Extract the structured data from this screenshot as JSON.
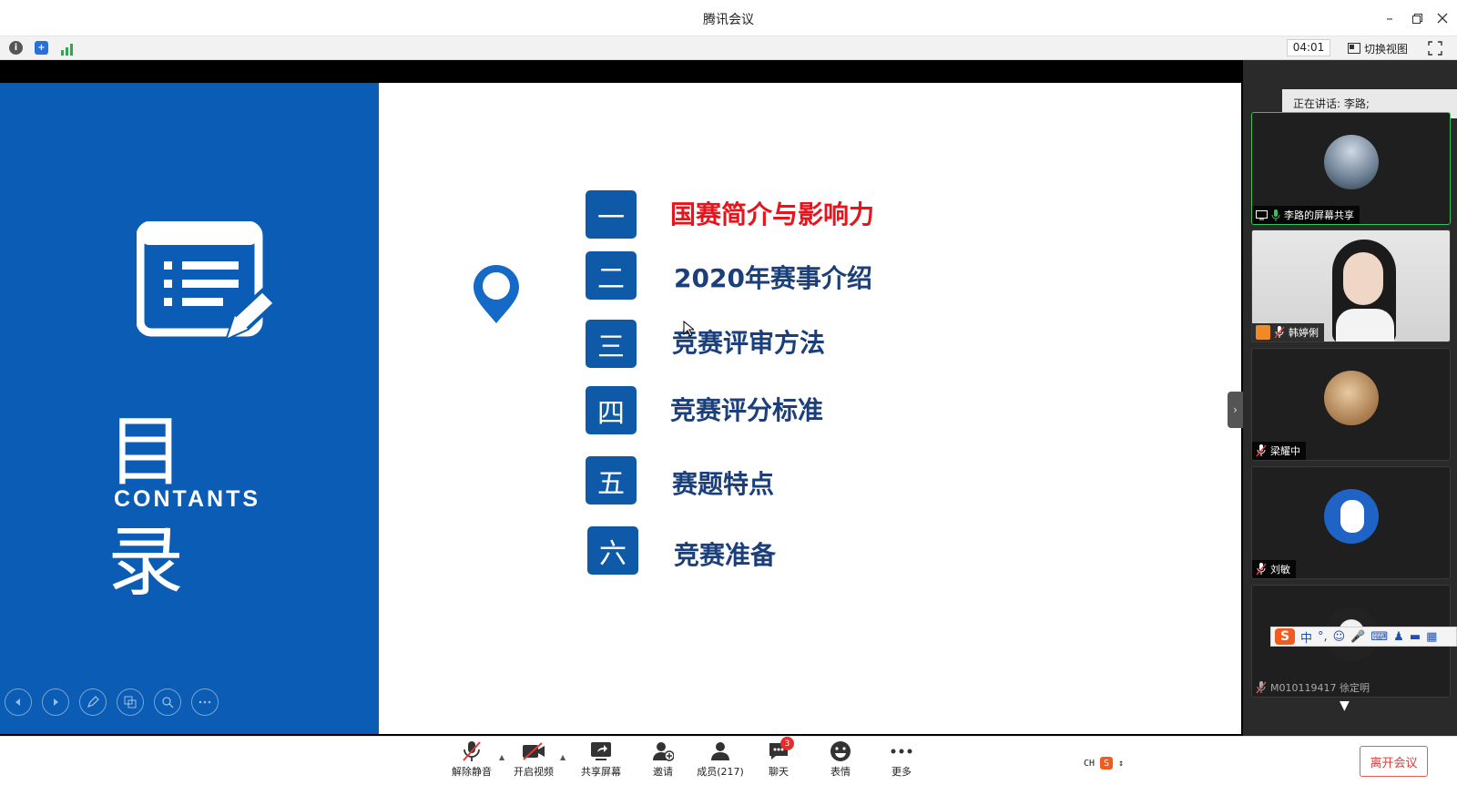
{
  "window": {
    "title": "腾讯会议"
  },
  "infobar": {
    "timer": "04:01",
    "switch_view_label": "切换视图"
  },
  "slide": {
    "title": "目 录",
    "subtitle": "CONTANTS",
    "items": [
      {
        "num": "一",
        "label": "国赛简介与影响力",
        "active": true
      },
      {
        "num": "二",
        "label": "2020年赛事介绍",
        "active": false
      },
      {
        "num": "三",
        "label": "竞赛评审方法",
        "active": false
      },
      {
        "num": "四",
        "label": "竞赛评分标准",
        "active": false
      },
      {
        "num": "五",
        "label": "赛题特点",
        "active": false
      },
      {
        "num": "六",
        "label": "竞赛准备",
        "active": false
      }
    ],
    "accent_color": "#0a5cb4",
    "active_color": "#e8141b"
  },
  "panel": {
    "speaking_label": "正在讲话: 李路;",
    "participants": [
      {
        "name": "李路的屏幕共享",
        "sharing": true
      },
      {
        "name": "韩婷俐",
        "sharing": false
      },
      {
        "name": "梁耀中",
        "sharing": false
      },
      {
        "name": "刘敏",
        "sharing": false
      },
      {
        "name": "M010119417 徐定明",
        "sharing": false
      }
    ],
    "ime": {
      "mode": "中",
      "punct": "°,"
    }
  },
  "toolbar": {
    "unmute": "解除静音",
    "video": "开启视频",
    "share": "共享屏幕",
    "invite": "邀请",
    "members": "成员(217)",
    "chat": "聊天",
    "chat_badge": "3",
    "emoji": "表情",
    "more": "更多",
    "leave": "离开会议",
    "lang": "CH"
  }
}
